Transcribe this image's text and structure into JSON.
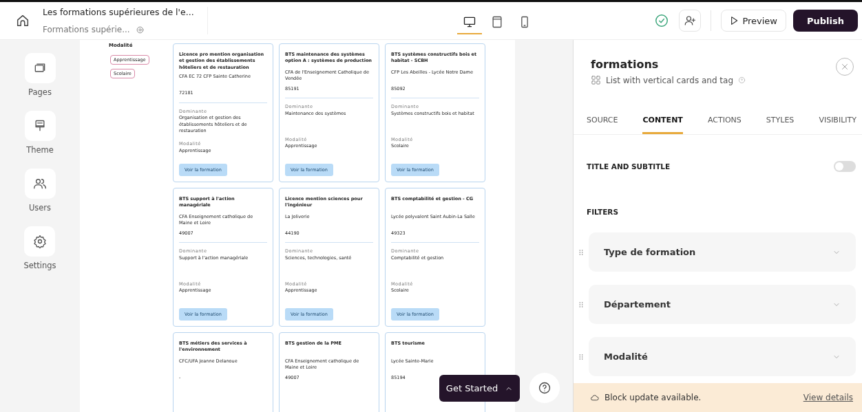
{
  "header": {
    "page_title": "Les formations supérieures de l'e...",
    "page_subtitle": "Formations supérie...",
    "devices": [
      {
        "kind": "desktop",
        "selected": true
      },
      {
        "kind": "tablet",
        "selected": false
      },
      {
        "kind": "mobile",
        "selected": false
      }
    ],
    "preview": "Preview",
    "publish": "Publish"
  },
  "sidebar": {
    "items": [
      {
        "kind": "pages",
        "label": "Pages"
      },
      {
        "kind": "theme",
        "label": "Theme"
      },
      {
        "kind": "users",
        "label": "Users"
      },
      {
        "kind": "settings",
        "label": "Settings"
      }
    ]
  },
  "canvas": {
    "filter_title": "Modalité",
    "filter_tags": [
      "Apprentissage",
      "Scolaire"
    ],
    "cards": [
      {
        "title": "Licence pro mention organisation et gestion des établissements hôteliers et de restauration",
        "school": "CFA EC 72 CFP Sainte Catherine",
        "code": "72181",
        "dominante_label": "Dominante",
        "dominante": "Organisation et gestion des établissements hôteliers et de restauration",
        "modalite_label": "Modalité",
        "modalite": "Apprentissage",
        "button": "Voir la formation"
      },
      {
        "title": "BTS maintenance des systèmes option A : systèmes de production",
        "school": "CFA de l'Enseignement Catholique de Vendée",
        "code": "85191",
        "dominante_label": "Dominante",
        "dominante": "Maintenance des systèmes",
        "modalite_label": "Modalité",
        "modalite": "Apprentissage",
        "button": "Voir la formation"
      },
      {
        "title": "BTS systèmes constructifs bois et habitat - SCBH",
        "school": "CFP Les Abeilles - Lycée Notre Dame",
        "code": "85092",
        "dominante_label": "Dominante",
        "dominante": "Systèmes constructifs bois et habitat",
        "modalite_label": "Modalité",
        "modalite": "Scolaire",
        "button": "Voir la formation"
      },
      {
        "title": "BTS support à l'action managériale",
        "school": "CFA Enseignement catholique de Maine et Loire",
        "code": "49007",
        "dominante_label": "Dominante",
        "dominante": "Support à l'action managériale",
        "modalite_label": "Modalité",
        "modalite": "Apprentissage",
        "button": "Voir la formation"
      },
      {
        "title": "Licence mention sciences pour l'ingénieur",
        "school": "La Joliverie",
        "code": "44190",
        "dominante_label": "Dominante",
        "dominante": "Sciences, technologies, santé",
        "modalite_label": "Modalité",
        "modalite": "Apprentissage",
        "button": "Voir la formation"
      },
      {
        "title": "BTS comptabilité et gestion - CG",
        "school": "Lycée polyvalent Saint Aubin-La Salle",
        "code": "49323",
        "dominante_label": "Dominante",
        "dominante": "Comptabilité et gestion",
        "modalite_label": "Modalité",
        "modalite": "Scolaire",
        "button": "Voir la formation"
      },
      {
        "title": "BTS métiers des services à l'environnement",
        "school": "CFC/UFA Jeanne Delanoue",
        "code": "-"
      },
      {
        "title": "BTS gestion de la PME",
        "school": "CFA Enseignement catholique de Maine et Loire",
        "code": "49007"
      },
      {
        "title": "BTS tourisme",
        "school": "Lycée Sainte-Marie",
        "code": "85194"
      }
    ],
    "get_started": "Get Started"
  },
  "panel": {
    "title": "formations",
    "subtitle": "List with vertical cards and tag",
    "tabs": [
      {
        "label": "SOURCE",
        "selected": false
      },
      {
        "label": "CONTENT",
        "selected": true
      },
      {
        "label": "ACTIONS",
        "selected": false
      },
      {
        "label": "STYLES",
        "selected": false
      },
      {
        "label": "VISIBILITY",
        "selected": false
      }
    ],
    "title_toggle": {
      "label": "TITLE AND SUBTITLE",
      "on": false
    },
    "filters_label": "FILTERS",
    "filters": [
      "Type de formation",
      "Département",
      "Modalité"
    ],
    "update_bar": {
      "text": "Block update available.",
      "link": "View details"
    }
  }
}
